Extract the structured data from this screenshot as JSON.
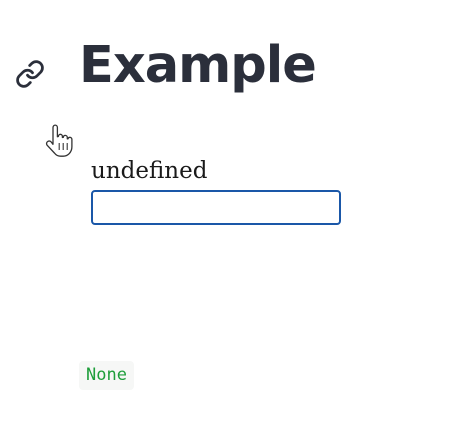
{
  "header": {
    "title": "Example",
    "anchor_icon": "link-icon"
  },
  "cursor": {
    "icon": "hand-pointer-cursor-icon"
  },
  "form": {
    "input_label": "undefined",
    "input_value": ""
  },
  "output": {
    "value": "None",
    "color": "#1e9e3b"
  },
  "colors": {
    "title": "#2b2f3b",
    "input_border": "#1a57a8",
    "code_background": "#f6f7f6"
  }
}
